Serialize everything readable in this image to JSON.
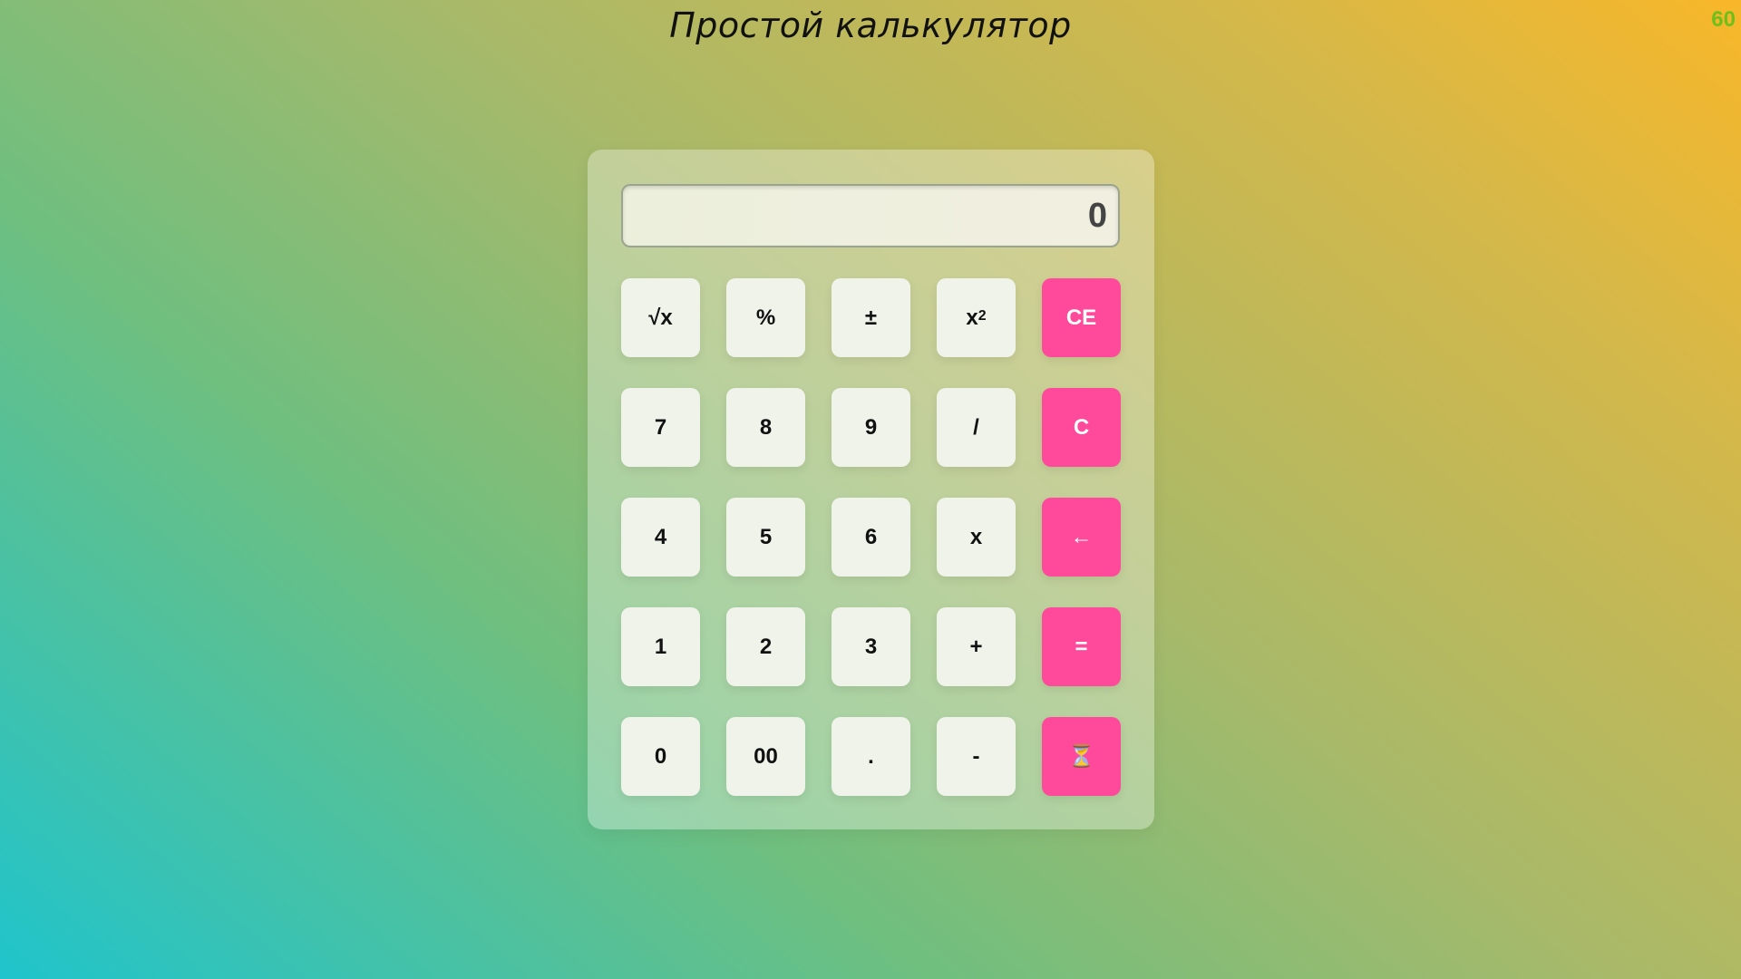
{
  "page": {
    "title": "Простой калькулятор",
    "fps": "60"
  },
  "calculator": {
    "display_value": "0",
    "keys": [
      {
        "id": "sqrt",
        "label": "√x",
        "accent": false
      },
      {
        "id": "percent",
        "label": "%",
        "accent": false
      },
      {
        "id": "plus-minus",
        "label": "±",
        "accent": false
      },
      {
        "id": "square",
        "label": "x",
        "sup": "2",
        "accent": false
      },
      {
        "id": "clear-entry",
        "label": "CE",
        "accent": true
      },
      {
        "id": "digit-7",
        "label": "7",
        "accent": false
      },
      {
        "id": "digit-8",
        "label": "8",
        "accent": false
      },
      {
        "id": "digit-9",
        "label": "9",
        "accent": false
      },
      {
        "id": "divide",
        "label": "/",
        "accent": false
      },
      {
        "id": "clear",
        "label": "C",
        "accent": true
      },
      {
        "id": "digit-4",
        "label": "4",
        "accent": false
      },
      {
        "id": "digit-5",
        "label": "5",
        "accent": false
      },
      {
        "id": "digit-6",
        "label": "6",
        "accent": false
      },
      {
        "id": "multiply",
        "label": "x",
        "accent": false
      },
      {
        "id": "backspace",
        "label": "←",
        "accent": true
      },
      {
        "id": "digit-1",
        "label": "1",
        "accent": false
      },
      {
        "id": "digit-2",
        "label": "2",
        "accent": false
      },
      {
        "id": "digit-3",
        "label": "3",
        "accent": false
      },
      {
        "id": "add",
        "label": "+",
        "accent": false
      },
      {
        "id": "equals",
        "label": "=",
        "accent": true
      },
      {
        "id": "digit-0",
        "label": "0",
        "accent": false
      },
      {
        "id": "double-zero",
        "label": "00",
        "accent": false
      },
      {
        "id": "decimal",
        "label": ".",
        "accent": false
      },
      {
        "id": "subtract",
        "label": "-",
        "accent": false
      },
      {
        "id": "history",
        "label": "⏳",
        "accent": true
      }
    ]
  },
  "colors": {
    "accent": "#ff4a9b",
    "key_background": "#f0f3ea",
    "fps_text": "#6fbf1a"
  }
}
